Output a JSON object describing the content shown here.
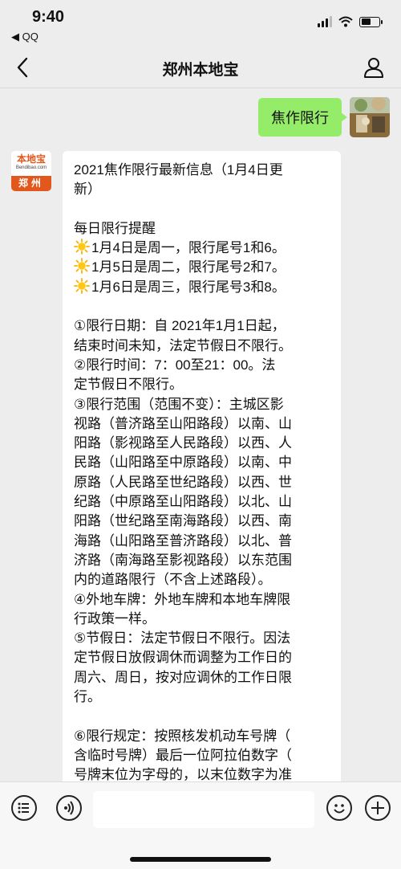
{
  "status_bar": {
    "time": "9:40",
    "back_app": "◀ QQ"
  },
  "nav": {
    "title": "郑州本地宝"
  },
  "chat": {
    "sent_message": "焦作限行",
    "bot_avatar": {
      "logo_text": "本地宝",
      "logo_sub": "Bendibao.com",
      "city": "郑州"
    },
    "reply_lines": [
      {
        "text": "2021焦作限行最新信息（1月4日更"
      },
      {
        "text": "新）"
      },
      {
        "text": ""
      },
      {
        "text": "每日限行提醒"
      },
      {
        "text": "1月4日是周一，限行尾号1和6。",
        "icon": "sun-icon"
      },
      {
        "text": "1月5日是周二，限行尾号2和7。",
        "icon": "sun-icon"
      },
      {
        "text": "1月6日是周三，限行尾号3和8。",
        "icon": "sun-icon"
      },
      {
        "text": ""
      },
      {
        "text": "①限行日期：自 2021年1月1日起，"
      },
      {
        "text": "结束时间未知，法定节假日不限行。"
      },
      {
        "text": "②限行时间：7：00至21：00。法"
      },
      {
        "text": "定节假日不限行。"
      },
      {
        "text": "③限行范围（范围不变）：主城区影"
      },
      {
        "text": "视路（普济路至山阳路段）以南、山"
      },
      {
        "text": "阳路（影视路至人民路段）以西、人"
      },
      {
        "text": "民路（山阳路至中原路段）以南、中"
      },
      {
        "text": "原路（人民路至世纪路段）以西、世"
      },
      {
        "text": "纪路（中原路至山阳路段）以北、山"
      },
      {
        "text": "阳路（世纪路至南海路段）以西、南"
      },
      {
        "text": "海路（山阳路至普济路段）以北、普"
      },
      {
        "text": "济路（南海路至影视路段）以东范围"
      },
      {
        "text": "内的道路限行（不含上述路段）。"
      },
      {
        "text": "④外地车牌：外地车牌和本地车牌限"
      },
      {
        "text": "行政策一样。"
      },
      {
        "text": "⑤节假日：法定节假日不限行。因法"
      },
      {
        "text": "定节假日放假调休而调整为工作日的"
      },
      {
        "text": "周六、周日，按对应调休的工作日限"
      },
      {
        "text": "行。"
      },
      {
        "text": ""
      },
      {
        "text": "⑥限行规定：按照核发机动车号牌（"
      },
      {
        "text": "含临时号牌）最后一位阿拉伯数字（"
      },
      {
        "text": "号牌末位为字母的，以末位数字为准"
      }
    ]
  },
  "input_bar": {
    "placeholder": ""
  },
  "colors": {
    "sent_bubble": "#95ec69",
    "background": "#ededed",
    "brand_orange": "#e2571b"
  },
  "icons": [
    "back-chevron-icon",
    "profile-icon",
    "voice-icon",
    "emoji-icon",
    "plus-icon",
    "sun-icon",
    "signal-icon",
    "wifi-icon",
    "battery-icon"
  ]
}
